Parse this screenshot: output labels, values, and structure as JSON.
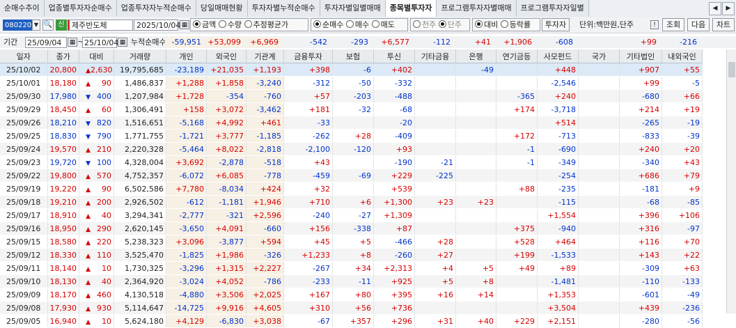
{
  "tabs": [
    "순매수추이",
    "업종별투자자순매수",
    "업종투자자누적순매수",
    "당일매매현황",
    "투자자별누적순매수",
    "투자자별일별매매",
    "종목별투자자",
    "프로그램투자자별매매",
    "프로그램투자자일별"
  ],
  "active_tab": 6,
  "toolbar": {
    "code": "080220",
    "badge": "신",
    "name": "제주반도체",
    "date": "2025/10/04",
    "radio_group1": [
      "금액",
      "수량",
      "추정평균가"
    ],
    "radio_group2": [
      "순매수",
      "매수",
      "매도"
    ],
    "radio_group3": [
      "천주",
      "단주"
    ],
    "radio_group4": [
      "대비",
      "등락률"
    ],
    "investor_btn": "투자자",
    "unit": "단위:백만원,단주",
    "btn_query": "조회",
    "btn_next": "다음",
    "btn_chart": "차트"
  },
  "period": {
    "label": "기간",
    "from": "25/09/04",
    "to": "25/10/04",
    "cum_label": "누적순매수",
    "sums": [
      "-59,951",
      "+53,099",
      "+6,969",
      "-542",
      "-293",
      "+6,577",
      "-112",
      "+41",
      "+1,906",
      "-608",
      "",
      "+99",
      "-216"
    ]
  },
  "columns": [
    "일자",
    "종가",
    "대비",
    "거래량",
    "개인",
    "외국인",
    "기관계",
    "금융투자",
    "보험",
    "투신",
    "기타금융",
    "은행",
    "연기금등",
    "사모펀드",
    "국가",
    "기타법인",
    "내외국인"
  ],
  "rows": [
    [
      "25/10/02",
      "20,800",
      "up",
      "2,630",
      "19,795,685",
      "-23,189",
      "+21,035",
      "+1,193",
      "+398",
      "-6",
      "+402",
      "",
      "-49",
      "",
      "+448",
      "",
      "+907",
      "+55"
    ],
    [
      "25/10/01",
      "18,180",
      "up",
      "90",
      "1,486,837",
      "+1,288",
      "+1,858",
      "-3,240",
      "-312",
      "-50",
      "-332",
      "",
      "",
      "",
      "-2,546",
      "",
      "+99",
      "-5"
    ],
    [
      "25/09/30",
      "17,980",
      "dn",
      "400",
      "1,207,984",
      "+1,728",
      "-354",
      "-760",
      "+57",
      "-203",
      "-488",
      "",
      "",
      "-365",
      "+240",
      "",
      "-680",
      "+66"
    ],
    [
      "25/09/29",
      "18,450",
      "up",
      "60",
      "1,306,491",
      "+158",
      "+3,072",
      "-3,462",
      "+181",
      "-32",
      "-68",
      "",
      "",
      "+174",
      "-3,718",
      "",
      "+214",
      "+19"
    ],
    [
      "25/09/26",
      "18,210",
      "dn",
      "820",
      "1,516,651",
      "-5,168",
      "+4,992",
      "+461",
      "-33",
      "",
      "-20",
      "",
      "",
      "",
      "+514",
      "",
      "-265",
      "-19"
    ],
    [
      "25/09/25",
      "18,830",
      "dn",
      "790",
      "1,771,755",
      "-1,721",
      "+3,777",
      "-1,185",
      "-262",
      "+28",
      "-409",
      "",
      "",
      "+172",
      "-713",
      "",
      "-833",
      "-39"
    ],
    [
      "25/09/24",
      "19,570",
      "up",
      "210",
      "2,220,328",
      "-5,464",
      "+8,022",
      "-2,818",
      "-2,100",
      "-120",
      "+93",
      "",
      "",
      "-1",
      "-690",
      "",
      "+240",
      "+20"
    ],
    [
      "25/09/23",
      "19,720",
      "dn",
      "100",
      "4,328,004",
      "+3,692",
      "-2,878",
      "-518",
      "+43",
      "",
      "-190",
      "-21",
      "",
      "-1",
      "-349",
      "",
      "-340",
      "+43"
    ],
    [
      "25/09/22",
      "19,800",
      "up",
      "570",
      "4,752,357",
      "-6,072",
      "+6,085",
      "-778",
      "-459",
      "-69",
      "+229",
      "-225",
      "",
      "",
      "-254",
      "",
      "+686",
      "+79"
    ],
    [
      "25/09/19",
      "19,220",
      "up",
      "90",
      "6,502,586",
      "+7,780",
      "-8,034",
      "+424",
      "+32",
      "",
      "+539",
      "",
      "",
      "+88",
      "-235",
      "",
      "-181",
      "+9"
    ],
    [
      "25/09/18",
      "19,210",
      "up",
      "200",
      "2,926,502",
      "-612",
      "-1,181",
      "+1,946",
      "+710",
      "+6",
      "+1,300",
      "+23",
      "+23",
      "",
      "-115",
      "",
      "-68",
      "-85"
    ],
    [
      "25/09/17",
      "18,910",
      "up",
      "40",
      "3,294,341",
      "-2,777",
      "-321",
      "+2,596",
      "-240",
      "-27",
      "+1,309",
      "",
      "",
      "",
      "+1,554",
      "",
      "+396",
      "+106"
    ],
    [
      "25/09/16",
      "18,950",
      "up",
      "290",
      "2,620,145",
      "-3,650",
      "+4,091",
      "-660",
      "+156",
      "-338",
      "+87",
      "",
      "",
      "+375",
      "-940",
      "",
      "+316",
      "-97"
    ],
    [
      "25/09/15",
      "18,580",
      "up",
      "220",
      "5,238,323",
      "+3,096",
      "-3,877",
      "+594",
      "+45",
      "+5",
      "-466",
      "+28",
      "",
      "+528",
      "+464",
      "",
      "+116",
      "+70"
    ],
    [
      "25/09/12",
      "18,330",
      "up",
      "110",
      "3,525,470",
      "-1,825",
      "+1,986",
      "-326",
      "+1,233",
      "+8",
      "-260",
      "+27",
      "",
      "+199",
      "-1,533",
      "",
      "+143",
      "+22"
    ],
    [
      "25/09/11",
      "18,140",
      "up",
      "10",
      "1,730,325",
      "-3,296",
      "+1,315",
      "+2,227",
      "-267",
      "+34",
      "+2,313",
      "+4",
      "+5",
      "+49",
      "+89",
      "",
      "-309",
      "+63"
    ],
    [
      "25/09/10",
      "18,130",
      "up",
      "40",
      "2,364,920",
      "-3,024",
      "+4,052",
      "-786",
      "-233",
      "-11",
      "+925",
      "+5",
      "+8",
      "",
      "-1,481",
      "",
      "-110",
      "-133"
    ],
    [
      "25/09/09",
      "18,170",
      "up",
      "460",
      "4,130,518",
      "-4,880",
      "+3,506",
      "+2,025",
      "+167",
      "+80",
      "+395",
      "+16",
      "+14",
      "",
      "+1,353",
      "",
      "-601",
      "-49"
    ],
    [
      "25/09/08",
      "17,930",
      "up",
      "930",
      "5,114,647",
      "-14,725",
      "+9,916",
      "+4,605",
      "+310",
      "+56",
      "+736",
      "",
      "",
      "",
      "+3,504",
      "",
      "+439",
      "-236"
    ],
    [
      "25/09/05",
      "16,940",
      "up",
      "10",
      "5,624,180",
      "+4,129",
      "-6,830",
      "+3,038",
      "-67",
      "+357",
      "+296",
      "+31",
      "+40",
      "+229",
      "+2,151",
      "",
      "-280",
      "-56"
    ]
  ],
  "colors": {
    "up": "#d70000",
    "down": "#0033cc",
    "selected_row": "#dbeaf6",
    "tint": "#f7f0e4"
  }
}
